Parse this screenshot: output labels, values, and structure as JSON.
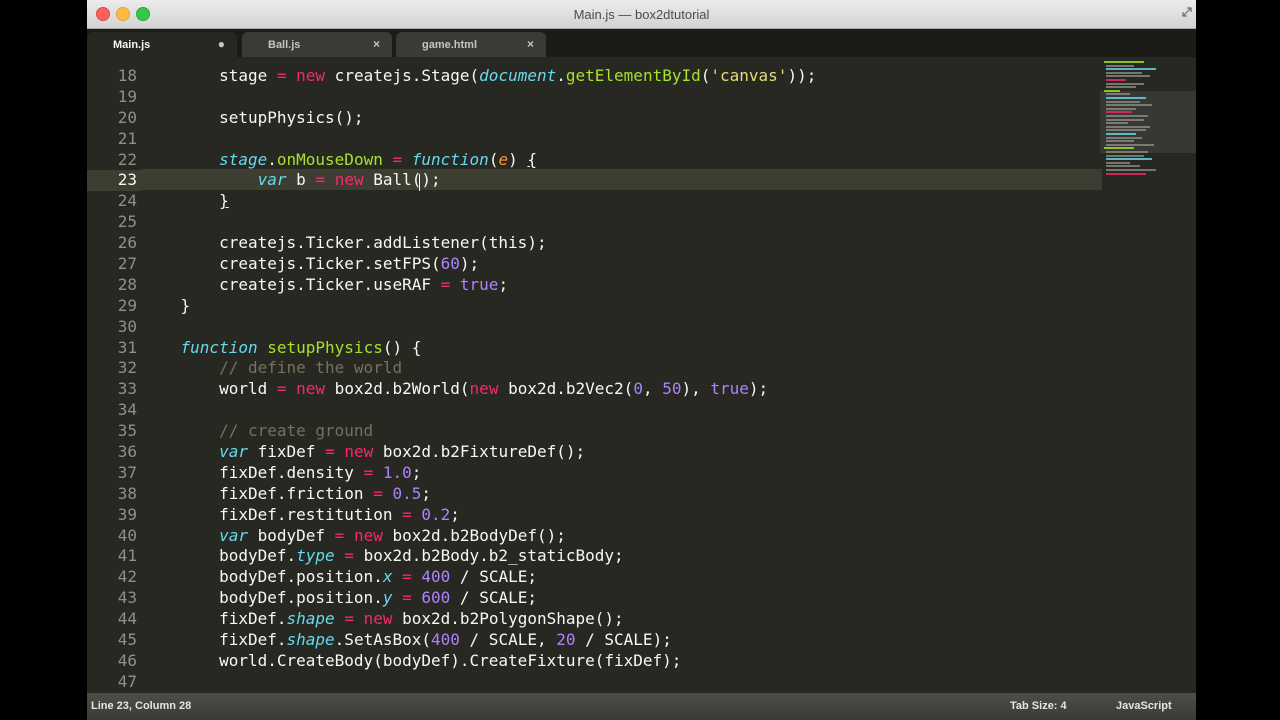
{
  "window": {
    "title": "Main.js — box2dtutorial"
  },
  "tabs": [
    {
      "label": "Main.js",
      "state": "modified-active",
      "icon": "dot-icon",
      "icon_char": "●"
    },
    {
      "label": "Ball.js",
      "state": "open",
      "icon": "close-icon",
      "icon_char": "×"
    },
    {
      "label": "game.html",
      "state": "open",
      "icon": "close-icon",
      "icon_char": "×"
    }
  ],
  "editor": {
    "current_line": 23,
    "lines": [
      {
        "n": "18",
        "t": [
          [
            "        ",
            ""
          ],
          [
            "stage",
            ""
          ],
          [
            " = ",
            "ck"
          ],
          [
            "new",
            "ck"
          ],
          [
            " createjs.Stage(",
            ""
          ],
          [
            "document",
            "cs"
          ],
          [
            ".",
            ""
          ],
          [
            "getElementById",
            "cf"
          ],
          [
            "(",
            ""
          ],
          [
            "'canvas'",
            "cst"
          ],
          [
            "));",
            ""
          ]
        ]
      },
      {
        "n": "19",
        "t": []
      },
      {
        "n": "20",
        "t": [
          [
            "        setupPhysics();",
            ""
          ]
        ]
      },
      {
        "n": "21",
        "t": []
      },
      {
        "n": "22",
        "t": [
          [
            "        ",
            ""
          ],
          [
            "stage",
            "cs"
          ],
          [
            ".",
            ""
          ],
          [
            "onMouseDown",
            "cf"
          ],
          [
            " = ",
            "ck"
          ],
          [
            "function",
            "cs"
          ],
          [
            "(",
            ""
          ],
          [
            "e",
            "cp"
          ],
          [
            ") ",
            ""
          ],
          [
            "{",
            "cu"
          ]
        ]
      },
      {
        "n": "23",
        "t": [
          [
            "            ",
            ""
          ],
          [
            "var",
            "cs"
          ],
          [
            " b ",
            ""
          ],
          [
            "=",
            "ck"
          ],
          [
            " ",
            ""
          ],
          [
            "new",
            "ck"
          ],
          [
            " Ball();",
            ""
          ]
        ]
      },
      {
        "n": "24",
        "t": [
          [
            "        ",
            ""
          ],
          [
            "}",
            "cu"
          ]
        ]
      },
      {
        "n": "25",
        "t": []
      },
      {
        "n": "26",
        "t": [
          [
            "        createjs.Ticker.addListener(this);",
            ""
          ]
        ]
      },
      {
        "n": "27",
        "t": [
          [
            "        createjs.Ticker.setFPS(",
            ""
          ],
          [
            "60",
            "cn"
          ],
          [
            ");",
            ""
          ]
        ]
      },
      {
        "n": "28",
        "t": [
          [
            "        createjs.Ticker.useRAF ",
            ""
          ],
          [
            "=",
            "ck"
          ],
          [
            " ",
            ""
          ],
          [
            "true",
            "cn"
          ],
          [
            ";",
            ""
          ]
        ]
      },
      {
        "n": "29",
        "t": [
          [
            "    }",
            ""
          ]
        ]
      },
      {
        "n": "30",
        "t": []
      },
      {
        "n": "31",
        "t": [
          [
            "    ",
            ""
          ],
          [
            "function",
            "cs"
          ],
          [
            " ",
            ""
          ],
          [
            "setupPhysics",
            "cf"
          ],
          [
            "() {",
            ""
          ]
        ]
      },
      {
        "n": "32",
        "t": [
          [
            "        ",
            ""
          ],
          [
            "// define the world",
            "cc"
          ]
        ]
      },
      {
        "n": "33",
        "t": [
          [
            "        world ",
            ""
          ],
          [
            "=",
            "ck"
          ],
          [
            " ",
            ""
          ],
          [
            "new",
            "ck"
          ],
          [
            " box2d.b2World(",
            ""
          ],
          [
            "new",
            "ck"
          ],
          [
            " box2d.b2Vec2(",
            ""
          ],
          [
            "0",
            "cn"
          ],
          [
            ", ",
            ""
          ],
          [
            "50",
            "cn"
          ],
          [
            "), ",
            ""
          ],
          [
            "true",
            "cn"
          ],
          [
            ");",
            ""
          ]
        ]
      },
      {
        "n": "34",
        "t": []
      },
      {
        "n": "35",
        "t": [
          [
            "        ",
            ""
          ],
          [
            "// create ground",
            "cc"
          ]
        ]
      },
      {
        "n": "36",
        "t": [
          [
            "        ",
            ""
          ],
          [
            "var",
            "cs"
          ],
          [
            " fixDef ",
            ""
          ],
          [
            "=",
            "ck"
          ],
          [
            " ",
            ""
          ],
          [
            "new",
            "ck"
          ],
          [
            " box2d.b2FixtureDef();",
            ""
          ]
        ]
      },
      {
        "n": "37",
        "t": [
          [
            "        fixDef.density ",
            ""
          ],
          [
            "=",
            "ck"
          ],
          [
            " ",
            ""
          ],
          [
            "1.0",
            "cn"
          ],
          [
            ";",
            ""
          ]
        ]
      },
      {
        "n": "38",
        "t": [
          [
            "        fixDef.friction ",
            ""
          ],
          [
            "=",
            "ck"
          ],
          [
            " ",
            ""
          ],
          [
            "0.5",
            "cn"
          ],
          [
            ";",
            ""
          ]
        ]
      },
      {
        "n": "39",
        "t": [
          [
            "        fixDef.restitution ",
            ""
          ],
          [
            "=",
            "ck"
          ],
          [
            " ",
            ""
          ],
          [
            "0.2",
            "cn"
          ],
          [
            ";",
            ""
          ]
        ]
      },
      {
        "n": "40",
        "t": [
          [
            "        ",
            ""
          ],
          [
            "var",
            "cs"
          ],
          [
            " bodyDef ",
            ""
          ],
          [
            "=",
            "ck"
          ],
          [
            " ",
            ""
          ],
          [
            "new",
            "ck"
          ],
          [
            " box2d.b2BodyDef();",
            ""
          ]
        ]
      },
      {
        "n": "41",
        "t": [
          [
            "        bodyDef.",
            ""
          ],
          [
            "type",
            "cs"
          ],
          [
            " ",
            ""
          ],
          [
            "=",
            "ck"
          ],
          [
            " box2d.b2Body.b2_staticBody;",
            ""
          ]
        ]
      },
      {
        "n": "42",
        "t": [
          [
            "        bodyDef.position.",
            ""
          ],
          [
            "x",
            "cs"
          ],
          [
            " ",
            ""
          ],
          [
            "=",
            "ck"
          ],
          [
            " ",
            ""
          ],
          [
            "400",
            "cn"
          ],
          [
            " / SCALE;",
            ""
          ]
        ]
      },
      {
        "n": "43",
        "t": [
          [
            "        bodyDef.position.",
            ""
          ],
          [
            "y",
            "cs"
          ],
          [
            " ",
            ""
          ],
          [
            "=",
            "ck"
          ],
          [
            " ",
            ""
          ],
          [
            "600",
            "cn"
          ],
          [
            " / SCALE;",
            ""
          ]
        ]
      },
      {
        "n": "44",
        "t": [
          [
            "        fixDef.",
            ""
          ],
          [
            "shape",
            "cs"
          ],
          [
            " ",
            ""
          ],
          [
            "=",
            "ck"
          ],
          [
            " ",
            ""
          ],
          [
            "new",
            "ck"
          ],
          [
            " box2d.b2PolygonShape();",
            ""
          ]
        ]
      },
      {
        "n": "45",
        "t": [
          [
            "        fixDef.",
            ""
          ],
          [
            "shape",
            "cs"
          ],
          [
            ".SetAsBox(",
            ""
          ],
          [
            "400",
            "cn"
          ],
          [
            " / SCALE, ",
            ""
          ],
          [
            "20",
            "cn"
          ],
          [
            " / SCALE);",
            ""
          ]
        ]
      },
      {
        "n": "46",
        "t": [
          [
            "        world.CreateBody(bodyDef).CreateFixture(fixDef);",
            ""
          ]
        ]
      },
      {
        "n": "47",
        "t": []
      }
    ]
  },
  "status": {
    "position": "Line 23, Column 28",
    "tab_size": "Tab Size: 4",
    "syntax": "JavaScript"
  },
  "colors": {
    "background": "#272822",
    "keyword": "#f92672",
    "storage": "#66d9ef",
    "function": "#a6e22e",
    "number": "#ae81ff",
    "string": "#e6db74",
    "comment": "#75715e"
  }
}
